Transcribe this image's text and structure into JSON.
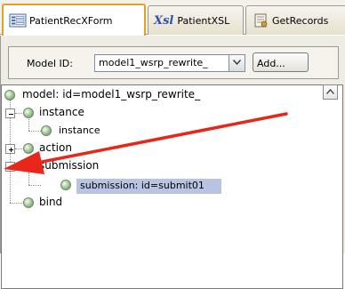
{
  "tabs": [
    {
      "label": "PatientRecXForm",
      "icon": "form-icon",
      "active": true
    },
    {
      "label": "PatientXSL",
      "icon_text": "Xsl",
      "icon": "xsl-icon",
      "active": false
    },
    {
      "label": "GetRecords",
      "icon": "document-icon",
      "active": false
    }
  ],
  "toolbar": {
    "model_id_label": "Model ID:",
    "model_id_value": "model1_wsrp_rewrite_",
    "add_label": "Add..."
  },
  "tree": {
    "root": "model: id=model1_wsrp_rewrite_",
    "instance": "instance",
    "instance_child": "instance",
    "action": "action",
    "submission": "submission",
    "submission_child": "submission: id=submit01",
    "bind": "bind"
  },
  "colors": {
    "active_tab_border": "#e2a12b",
    "selection": "#b8c4e2",
    "arrow": "#e8261a"
  }
}
